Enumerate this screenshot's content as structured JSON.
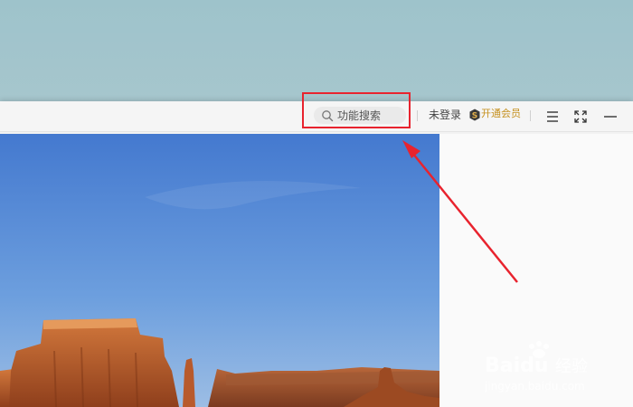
{
  "toolbar": {
    "search_placeholder": "功能搜索",
    "login_label": "未登录",
    "vip_label": "开通会员"
  },
  "icons": {
    "search": "search-icon",
    "vip": "vip-badge-icon",
    "menu": "menu-icon",
    "fullscreen": "fullscreen-icon",
    "minimize": "minimize-icon"
  },
  "watermark": {
    "brand": "Baidu",
    "product": "经验",
    "url": "jingyan.baidu.com"
  },
  "colors": {
    "highlight": "#e8232e",
    "vip": "#c5901e",
    "sky": "#4d86d6"
  }
}
